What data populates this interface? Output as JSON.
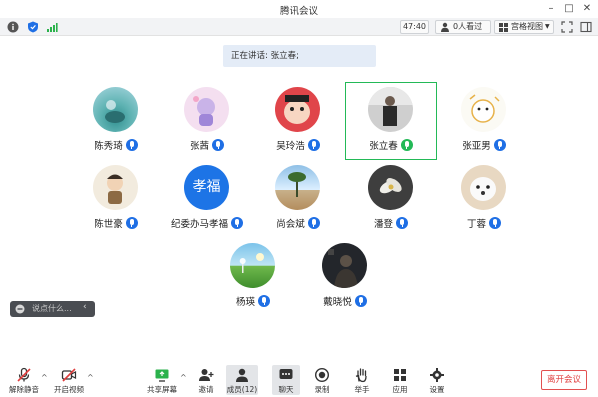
{
  "window": {
    "title": "腾讯会议"
  },
  "toolbar": {
    "timer": "47:40",
    "viewers": "0人看过",
    "view_mode": "宫格视图"
  },
  "speaking": {
    "text": "正在讲话: 张立春;"
  },
  "participants": [
    {
      "name": "陈秀琦"
    },
    {
      "name": "张茜"
    },
    {
      "name": "吴玲浩"
    },
    {
      "name": "张立春"
    },
    {
      "name": "张亚男"
    },
    {
      "name": "陈世豪"
    },
    {
      "name": "纪委办马孝福",
      "avatar_text": "孝福"
    },
    {
      "name": "尚会斌"
    },
    {
      "name": "潘登"
    },
    {
      "name": "丁蓉"
    },
    {
      "name": "杨瑛"
    },
    {
      "name": "戴晓悦"
    }
  ],
  "chat": {
    "placeholder": "说点什么..."
  },
  "bottombar": {
    "unmute": "解除静音",
    "video": "开启视频",
    "share": "共享屏幕",
    "invite": "邀请",
    "members": "成员(12)",
    "chat": "聊天",
    "record": "录制",
    "raise_hand": "举手",
    "apps": "应用",
    "settings": "设置",
    "leave": "离开会议"
  },
  "colors": {
    "accent": "#1f6fe5",
    "active_border": "#23b957",
    "leave": "#e03e3e"
  }
}
